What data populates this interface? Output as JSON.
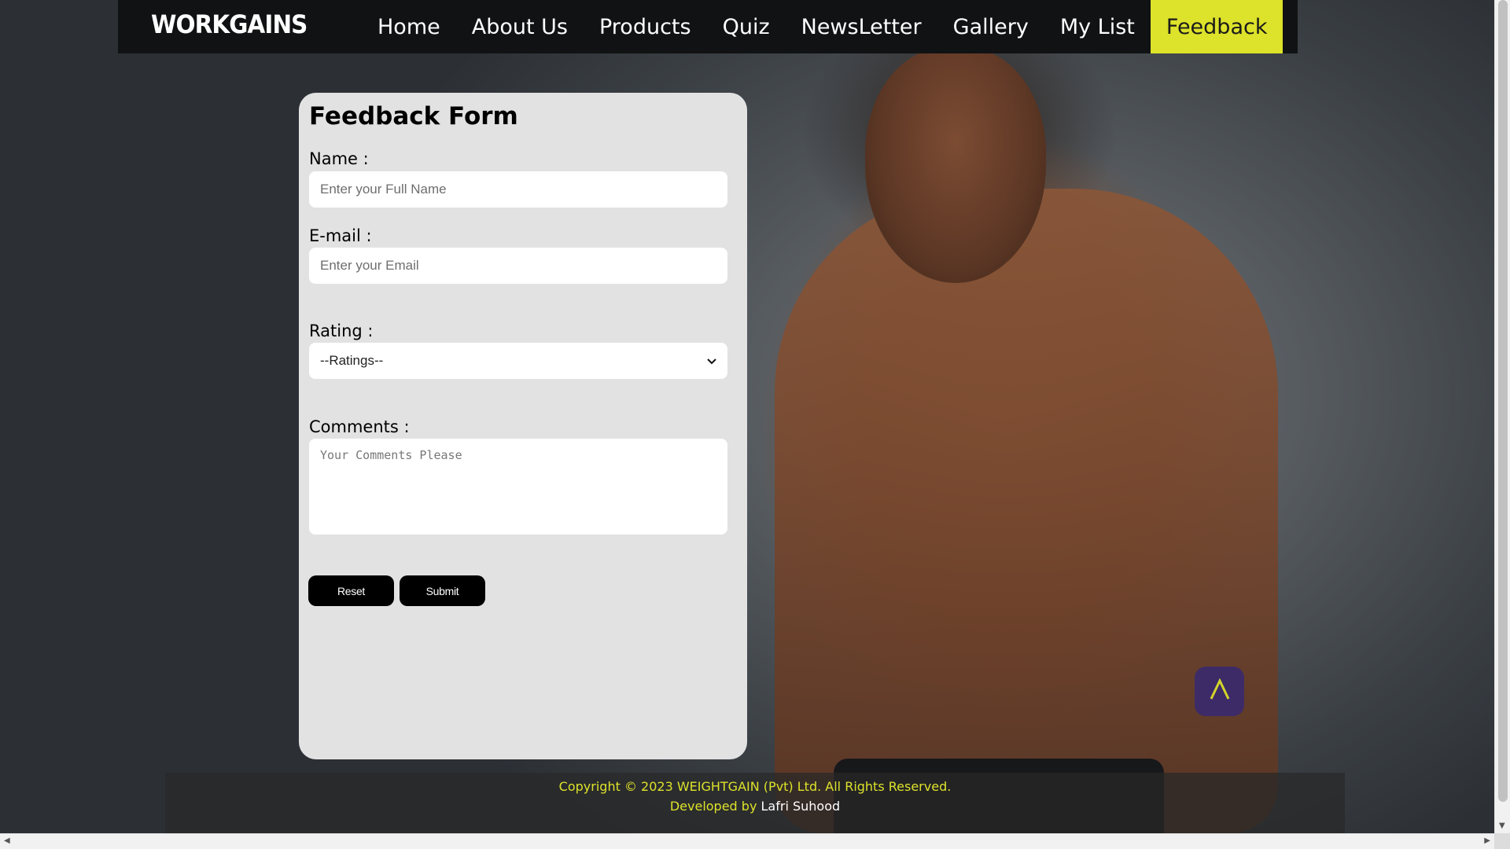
{
  "brand": {
    "logo": "WORKGAINS"
  },
  "nav": {
    "items": [
      {
        "label": "Home"
      },
      {
        "label": "About Us"
      },
      {
        "label": "Products"
      },
      {
        "label": "Quiz"
      },
      {
        "label": "NewsLetter"
      },
      {
        "label": "Gallery"
      },
      {
        "label": "My List"
      },
      {
        "label": "Feedback",
        "active": true
      }
    ]
  },
  "form": {
    "title": "Feedback Form",
    "name_label": "Name :",
    "name_placeholder": "Enter your Full Name",
    "email_label": "E-mail :",
    "email_placeholder": "Enter your Email",
    "rating_label": "Rating :",
    "rating_selected": "--Ratings--",
    "comments_label": "Comments :",
    "comments_placeholder": "Your Comments Please",
    "reset_label": "Reset",
    "submit_label": "Submit"
  },
  "scroll_top": {
    "glyph": "^"
  },
  "footer": {
    "copyright": "Copyright © 2023 WEIGHTGAIN (Pvt) Ltd. All Rights Reserved.",
    "developed_by": "Developed by",
    "developer": "Lafri Suhood"
  },
  "colors": {
    "accent": "#dde22a",
    "navbar_bg": "#111213",
    "card_bg": "#e2e2e2",
    "button_bg": "#000000",
    "scroll_top_bg": "#3a2a6e"
  },
  "icons": {
    "select_arrow": "chevron-down-icon",
    "scroll_top": "chevron-up-icon"
  }
}
